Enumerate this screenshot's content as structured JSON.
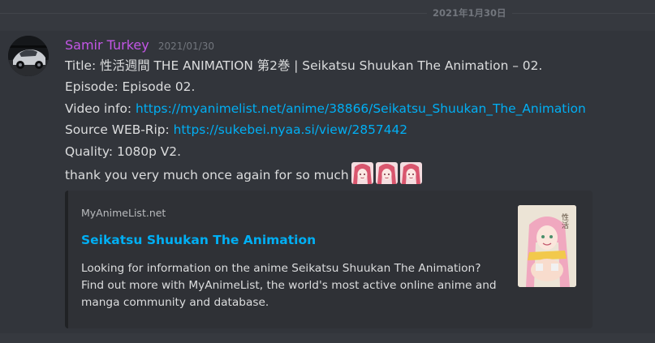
{
  "divider": {
    "date": "2021年1月30日"
  },
  "message": {
    "username": "Samir Turkey",
    "timestamp": "2021/01/30",
    "lines": {
      "title": "Title: 性活週間 THE ANIMATION 第2巻 | Seikatsu Shuukan The Animation – 02.",
      "episode": "Episode: Episode 02.",
      "video_label": "Video info: ",
      "video_link": "https://myanimelist.net/anime/38866/Seikatsu_Shuukan_The_Animation",
      "source_label": "Source WEB-Rip: ",
      "source_link": "https://sukebei.nyaa.si/view/2857442",
      "quality": "Quality: 1080p V2.",
      "thanks": "thank you very much once again for so much"
    },
    "emojis": [
      "anime-girl-emoji",
      "anime-girl-emoji",
      "anime-girl-emoji"
    ]
  },
  "embed": {
    "provider": "MyAnimeList.net",
    "title": "Seikatsu Shuukan The Animation",
    "description": "Looking for information on the anime Seikatsu Shuukan The Animation? Find out more with MyAnimeList, the world's most active online anime and manga community and database."
  },
  "colors": {
    "background": "#36393f",
    "username": "#c356e6",
    "link": "#00aff4",
    "text": "#dcddde"
  }
}
